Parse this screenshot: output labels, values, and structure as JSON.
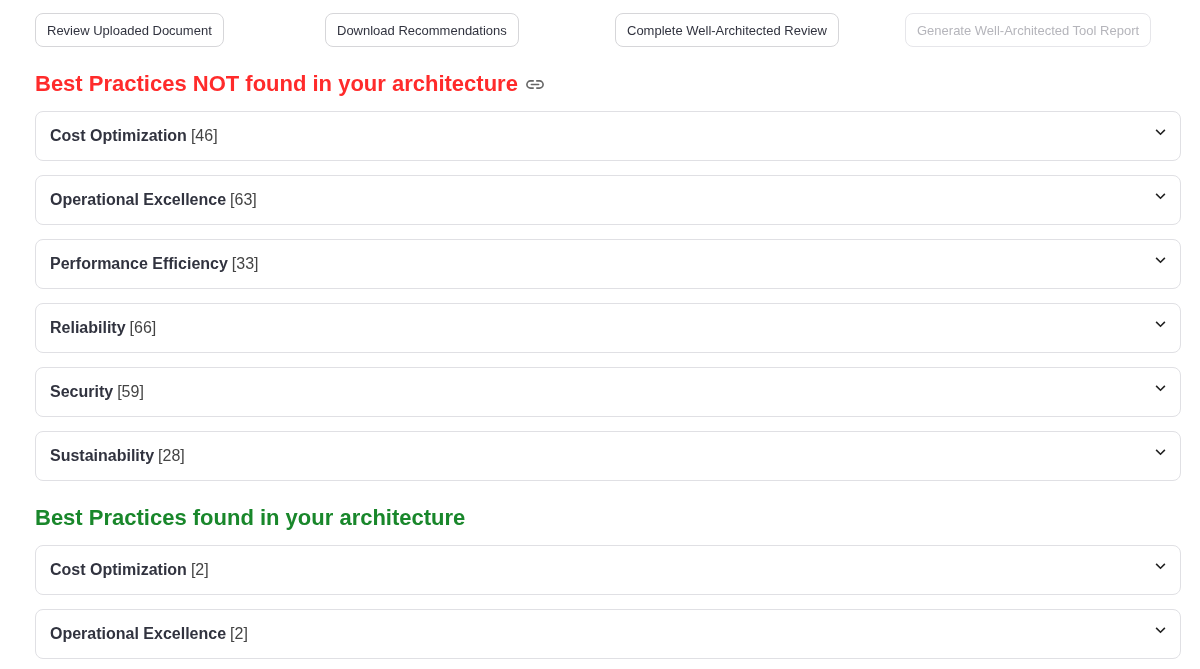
{
  "buttons": [
    {
      "label": "Review Uploaded Document",
      "disabled": false
    },
    {
      "label": "Download Recommendations",
      "disabled": false
    },
    {
      "label": "Complete Well-Architected Review",
      "disabled": false
    },
    {
      "label": "Generate Well-Architected Tool Report",
      "disabled": true
    }
  ],
  "sections": [
    {
      "kind": "not_found",
      "title": "Best Practices NOT found in your architecture",
      "link_icon": true,
      "items": [
        {
          "title": "Cost Optimization",
          "count": "[46]",
          "expanded": false
        },
        {
          "title": "Operational Excellence",
          "count": "[63]",
          "expanded": false
        },
        {
          "title": "Performance Efficiency",
          "count": "[33]",
          "expanded": false
        },
        {
          "title": "Reliability",
          "count": "[66]",
          "expanded": false
        },
        {
          "title": "Security",
          "count": "[59]",
          "expanded": false
        },
        {
          "title": "Sustainability",
          "count": "[28]",
          "expanded": false
        }
      ]
    },
    {
      "kind": "found",
      "title": "Best Practices found in your architecture",
      "items": [
        {
          "title": "Cost Optimization",
          "count": "[2]",
          "expanded": false
        },
        {
          "title": "Operational Excellence",
          "count": "[2]",
          "expanded": false
        }
      ]
    }
  ]
}
